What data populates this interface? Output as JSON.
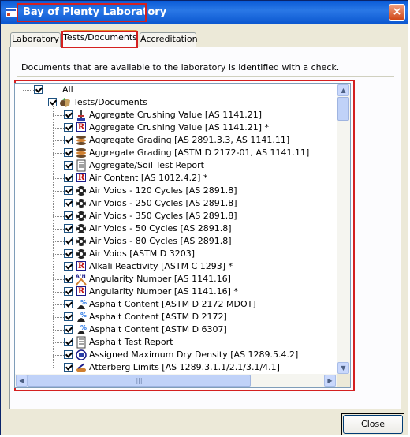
{
  "window": {
    "title": "Bay of Plenty Laboratory",
    "close_glyph": "×"
  },
  "tabs": [
    {
      "label": "Laboratory",
      "active": false
    },
    {
      "label": "Tests/Documents",
      "active": true
    },
    {
      "label": "Accreditation",
      "active": false
    }
  ],
  "info_text": "Documents that are available to the laboratory is identified with a check.",
  "tree": {
    "root": {
      "label": "All",
      "checked": true
    },
    "group": {
      "label": "Tests/Documents",
      "checked": true,
      "icon": "tests-documents-icon"
    },
    "items": [
      {
        "label": "Aggregate Crushing Value [AS 1141.21]",
        "icon": "crushing-icon",
        "checked": true
      },
      {
        "label": "Aggregate Crushing Value [AS 1141.21] *",
        "icon": "r-icon",
        "checked": true
      },
      {
        "label": "Aggregate Grading [AS 2891.3.3, AS 1141.11]",
        "icon": "grading-icon",
        "checked": true
      },
      {
        "label": "Aggregate Grading [ASTM D 2172-01, AS 1141.11]",
        "icon": "grading-icon",
        "checked": true
      },
      {
        "label": "Aggregate/Soil Test Report",
        "icon": "report-icon",
        "checked": true
      },
      {
        "label": "Air Content [AS 1012.4.2] *",
        "icon": "r-icon",
        "checked": true
      },
      {
        "label": "Air Voids - 120 Cycles [AS 2891.8]",
        "icon": "gear-icon",
        "checked": true
      },
      {
        "label": "Air Voids - 250 Cycles [AS 2891.8]",
        "icon": "gear-icon",
        "checked": true
      },
      {
        "label": "Air Voids - 350 Cycles [AS 2891.8]",
        "icon": "gear-icon",
        "checked": true
      },
      {
        "label": "Air Voids - 50 Cycles [AS 2891.8]",
        "icon": "gear-icon",
        "checked": true
      },
      {
        "label": "Air Voids - 80 Cycles [AS 2891.8]",
        "icon": "gear-icon",
        "checked": true
      },
      {
        "label": "Air Voids [ASTM D 3203]",
        "icon": "gear-icon",
        "checked": true
      },
      {
        "label": "Alkali Reactivity [ASTM C 1293] *",
        "icon": "r-icon",
        "checked": true
      },
      {
        "label": "Angularity Number [AS 1141.16]",
        "icon": "angularity-icon",
        "checked": true
      },
      {
        "label": "Angularity Number [AS 1141.16] *",
        "icon": "r-icon",
        "checked": true
      },
      {
        "label": "Asphalt Content [ASTM D 2172 MDOT]",
        "icon": "percent-icon",
        "checked": true
      },
      {
        "label": "Asphalt Content [ASTM D 2172]",
        "icon": "percent-icon",
        "checked": true
      },
      {
        "label": "Asphalt Content [ASTM D 6307]",
        "icon": "percent-icon",
        "checked": true
      },
      {
        "label": "Asphalt Test Report",
        "icon": "report-icon",
        "checked": true
      },
      {
        "label": "Assigned Maximum Dry Density [AS 1289.5.4.2]",
        "icon": "density-icon",
        "checked": true
      },
      {
        "label": "Atterberg Limits [AS 1289.3.1.1/2.1/3.1/4.1]",
        "icon": "atterberg-icon",
        "checked": true
      }
    ]
  },
  "buttons": {
    "close": "Close"
  },
  "scroll": {
    "up": "▲",
    "down": "▼",
    "left": "◀",
    "right": "▶",
    "grip": "|||"
  }
}
